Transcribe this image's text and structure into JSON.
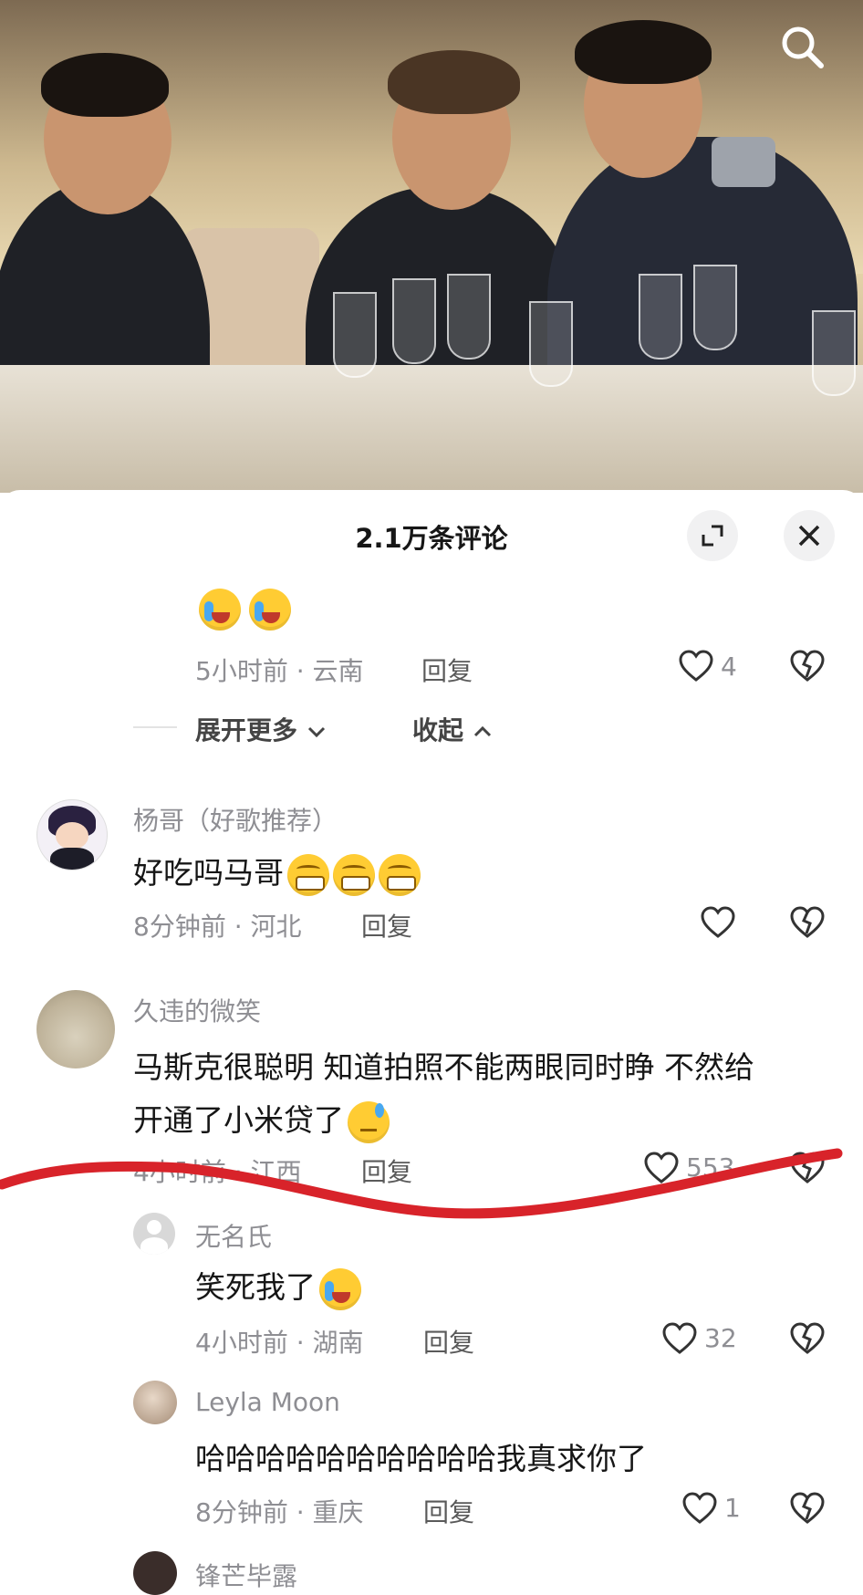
{
  "sheet": {
    "title": "2.1万条评论"
  },
  "thread": {
    "prev_meta": "5小时前 · 云南",
    "prev_reply": "回复",
    "prev_likes": "4",
    "expand_more": "展开更多",
    "collapse": "收起"
  },
  "comments": [
    {
      "user": "杨哥（好歌推荐）",
      "text": "好吃吗马哥",
      "meta": "8分钟前 · 河北",
      "reply": "回复",
      "likes": ""
    },
    {
      "user": "久违的微笑",
      "text_line1": "马斯克很聪明 知道拍照不能两眼同时睁 不然给",
      "text_line2": "开通了小米贷了",
      "meta": "4小时前 · 江西",
      "reply": "回复",
      "likes": "553"
    }
  ],
  "replies": [
    {
      "user": "无名氏",
      "text": "笑死我了",
      "meta": "4小时前 · 湖南",
      "reply": "回复",
      "likes": "32"
    },
    {
      "user": "Leyla Moon",
      "text": "哈哈哈哈哈哈哈哈哈哈我真求你了",
      "meta": "8分钟前 · 重庆",
      "reply": "回复",
      "likes": "1"
    },
    {
      "user": "锋芒毕露"
    }
  ],
  "colors": {
    "annotation_stroke": "#d8232a",
    "muted": "#8e8e93",
    "text": "#161616"
  },
  "icons": [
    "search-icon",
    "expand-icon",
    "close-icon",
    "heart-icon",
    "broken-heart-icon",
    "chevron-down-icon",
    "chevron-up-icon"
  ]
}
